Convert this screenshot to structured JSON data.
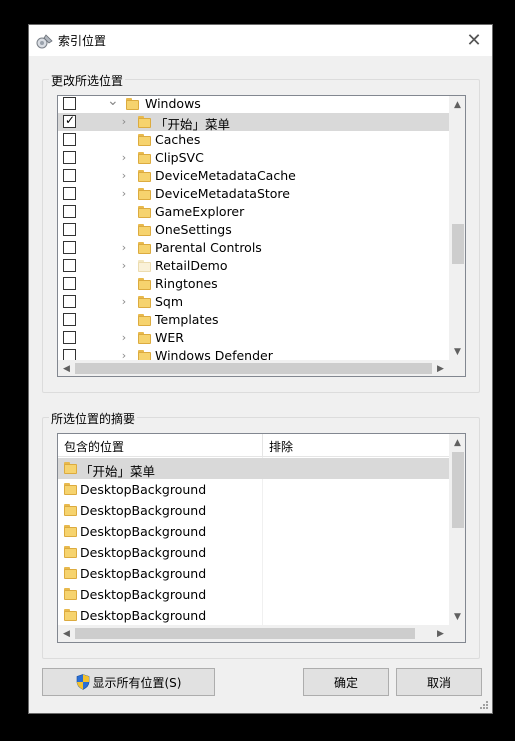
{
  "window": {
    "title": "索引位置",
    "close_glyph": "✕"
  },
  "tree_group": {
    "label": "更改所选位置"
  },
  "tree": {
    "rows": [
      {
        "label": "Windows",
        "checked": false,
        "expander": "down",
        "selected": false
      },
      {
        "label": "「开始」菜单",
        "checked": true,
        "expander": "right",
        "selected": true
      },
      {
        "label": "Caches",
        "checked": false,
        "expander": "none",
        "selected": false
      },
      {
        "label": "ClipSVC",
        "checked": false,
        "expander": "right",
        "selected": false
      },
      {
        "label": "DeviceMetadataCache",
        "checked": false,
        "expander": "right",
        "selected": false
      },
      {
        "label": "DeviceMetadataStore",
        "checked": false,
        "expander": "right",
        "selected": false
      },
      {
        "label": "GameExplorer",
        "checked": false,
        "expander": "none",
        "selected": false
      },
      {
        "label": "OneSettings",
        "checked": false,
        "expander": "none",
        "selected": false
      },
      {
        "label": "Parental Controls",
        "checked": false,
        "expander": "right",
        "selected": false
      },
      {
        "label": "RetailDemo",
        "checked": false,
        "expander": "right",
        "selected": false,
        "pale": true
      },
      {
        "label": "Ringtones",
        "checked": false,
        "expander": "none",
        "selected": false
      },
      {
        "label": "Sqm",
        "checked": false,
        "expander": "right",
        "selected": false
      },
      {
        "label": "Templates",
        "checked": false,
        "expander": "none",
        "selected": false
      },
      {
        "label": "WER",
        "checked": false,
        "expander": "right",
        "selected": false
      },
      {
        "label": "Windows Defender",
        "checked": false,
        "expander": "right",
        "selected": false
      }
    ]
  },
  "summary_group": {
    "label": "所选位置的摘要"
  },
  "summary": {
    "columns": [
      "包含的位置",
      "排除"
    ],
    "rows": [
      {
        "included": "「开始」菜单",
        "excluded": "",
        "selected": true
      },
      {
        "included": "DesktopBackground",
        "excluded": "",
        "selected": false
      },
      {
        "included": "DesktopBackground",
        "excluded": "",
        "selected": false
      },
      {
        "included": "DesktopBackground",
        "excluded": "",
        "selected": false
      },
      {
        "included": "DesktopBackground",
        "excluded": "",
        "selected": false
      },
      {
        "included": "DesktopBackground",
        "excluded": "",
        "selected": false
      },
      {
        "included": "DesktopBackground",
        "excluded": "",
        "selected": false
      },
      {
        "included": "DesktopBackground",
        "excluded": "",
        "selected": false
      }
    ]
  },
  "buttons": {
    "show_all": "显示所有位置(S)",
    "ok": "确定",
    "cancel": "取消"
  },
  "colors": {
    "dialog_bg": "#f0f0f0",
    "selection": "#d9d9d9",
    "folder": "#f6d36e",
    "shield_blue": "#2a6fd6",
    "shield_gold": "#f2c12e"
  }
}
